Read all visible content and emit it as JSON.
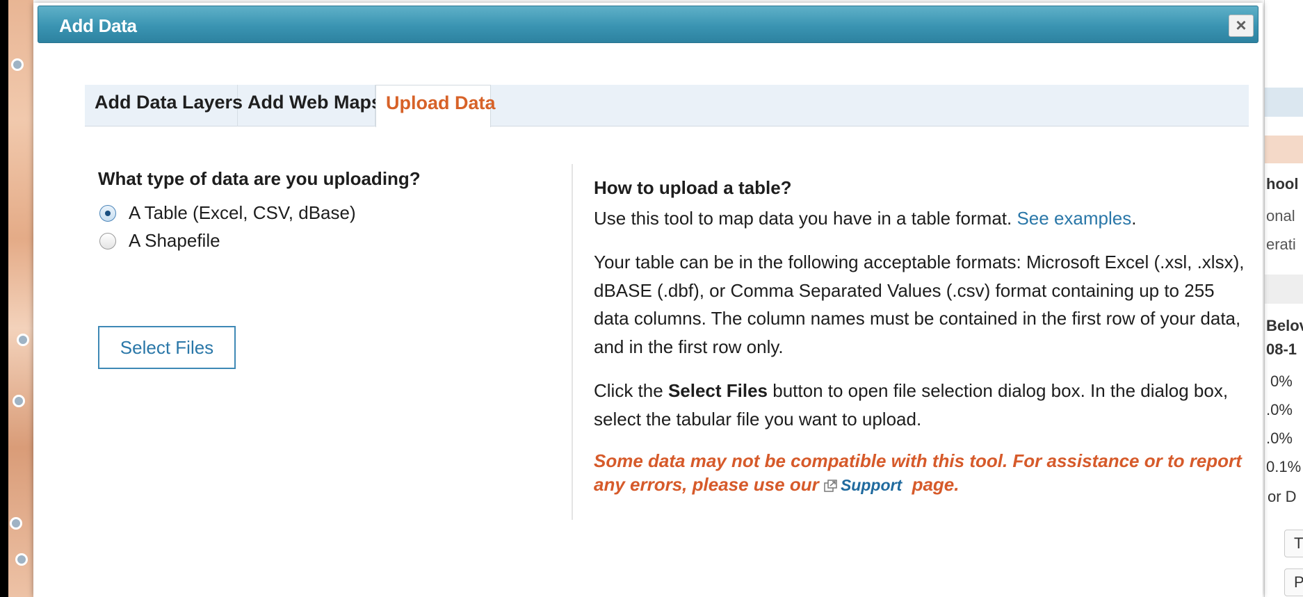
{
  "dialog": {
    "title": "Add Data",
    "close_glyph": "×"
  },
  "tabs": [
    {
      "label": "Add Data Layers"
    },
    {
      "label": "Add Web Maps"
    },
    {
      "label": "Upload Data",
      "active": true
    }
  ],
  "upload": {
    "question": "What type of data are you uploading?",
    "options": [
      {
        "label": "A Table (Excel, CSV, dBase)",
        "selected": true
      },
      {
        "label": "A Shapefile",
        "selected": false
      }
    ],
    "select_files_label": "Select Files"
  },
  "help": {
    "title": "How to upload a table?",
    "intro": "Use this tool to map data you have in a table format.",
    "see_examples": "See examples",
    "intro_end": ".",
    "formats": "Your table can be in the following acceptable formats: Microsoft Excel (.xsl, .xlsx), dBASE (.dbf), or Comma Separated Values (.csv) format containing up to 255 data columns. The column names must be contained in the first row of your data, and in the first row only.",
    "click_pre": "Click the",
    "click_bold": "Select Files",
    "click_post": "button to open file selection dialog box. In the dialog box, select the tabular file you want to upload.",
    "warning_text": "Some data may not be compatible with this tool. For assistance or to report any errors, please use our",
    "support_link": "Support",
    "warning_end": "page."
  },
  "background_panel": {
    "fragments": [
      "hool",
      "onal",
      "erati",
      "Belov",
      "08-1",
      "0%",
      ".0%",
      ".0%",
      "0.1%",
      "or D",
      "T",
      "P"
    ]
  },
  "colors": {
    "titlebar": "#3a94b2",
    "active_tab": "#d76228",
    "link": "#2a77a8",
    "warning": "#d65a2a"
  },
  "icons": {
    "close": "close-icon",
    "external_link": "external-link-icon",
    "radio_selected": "radio-selected-icon",
    "radio_unselected": "radio-unselected-icon"
  }
}
